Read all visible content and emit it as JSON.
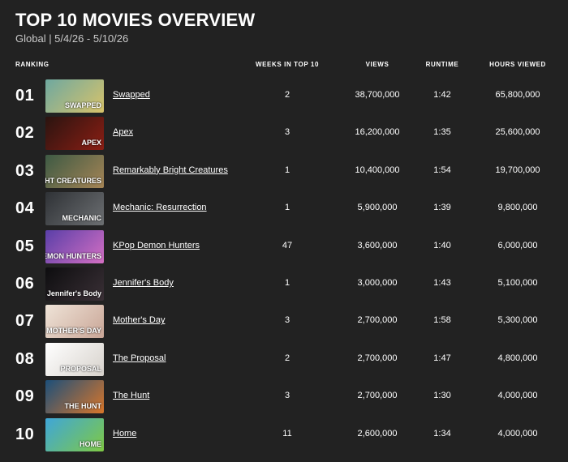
{
  "title": "TOP 10 MOVIES OVERVIEW",
  "subtitle": "Global | 5/4/26 - 5/10/26",
  "columns": {
    "ranking": "RANKING",
    "weeks": "WEEKS IN TOP 10",
    "views": "VIEWS",
    "runtime": "RUNTIME",
    "hours": "HOURS VIEWED"
  },
  "rows": [
    {
      "rank": "01",
      "name": "Swapped",
      "weeks": "2",
      "views": "38,700,000",
      "runtime": "1:42",
      "hours": "65,800,000",
      "thumb_text": "SWAPPED",
      "thumb_colors": [
        "#6ea8a0",
        "#d8c36a"
      ]
    },
    {
      "rank": "02",
      "name": "Apex",
      "weeks": "3",
      "views": "16,200,000",
      "runtime": "1:35",
      "hours": "25,600,000",
      "thumb_text": "APEX",
      "thumb_colors": [
        "#2a1410",
        "#8b1e14"
      ]
    },
    {
      "rank": "03",
      "name": "Remarkably Bright Creatures",
      "weeks": "1",
      "views": "10,400,000",
      "runtime": "1:54",
      "hours": "19,700,000",
      "thumb_text": "REMARKABLY BRIGHT CREATURES",
      "thumb_colors": [
        "#3d5a44",
        "#a58455"
      ]
    },
    {
      "rank": "04",
      "name": "Mechanic: Resurrection",
      "weeks": "1",
      "views": "5,900,000",
      "runtime": "1:39",
      "hours": "9,800,000",
      "thumb_text": "MECHANIC",
      "thumb_colors": [
        "#2f3236",
        "#6c6f72"
      ]
    },
    {
      "rank": "05",
      "name": "KPop Demon Hunters",
      "weeks": "47",
      "views": "3,600,000",
      "runtime": "1:40",
      "hours": "6,000,000",
      "thumb_text": "KPOP DEMON HUNTERS",
      "thumb_colors": [
        "#5a3fa8",
        "#d46fc3"
      ]
    },
    {
      "rank": "06",
      "name": "Jennifer's Body",
      "weeks": "1",
      "views": "3,000,000",
      "runtime": "1:43",
      "hours": "5,100,000",
      "thumb_text": "Jennifer's Body",
      "thumb_colors": [
        "#0d0d0f",
        "#3a3036"
      ]
    },
    {
      "rank": "07",
      "name": "Mother's Day",
      "weeks": "3",
      "views": "2,700,000",
      "runtime": "1:58",
      "hours": "5,300,000",
      "thumb_text": "MOTHER'S DAY",
      "thumb_colors": [
        "#efe4d8",
        "#c9a596"
      ]
    },
    {
      "rank": "08",
      "name": "The Proposal",
      "weeks": "2",
      "views": "2,700,000",
      "runtime": "1:47",
      "hours": "4,800,000",
      "thumb_text": "PROPOSAL",
      "thumb_colors": [
        "#ffffff",
        "#d7d2cc"
      ]
    },
    {
      "rank": "09",
      "name": "The Hunt",
      "weeks": "3",
      "views": "2,700,000",
      "runtime": "1:30",
      "hours": "4,000,000",
      "thumb_text": "THE HUNT",
      "thumb_colors": [
        "#1c4f7a",
        "#d9762a"
      ]
    },
    {
      "rank": "10",
      "name": "Home",
      "weeks": "11",
      "views": "2,600,000",
      "runtime": "1:34",
      "hours": "4,000,000",
      "thumb_text": "HOME",
      "thumb_colors": [
        "#3fa6d9",
        "#7fc943"
      ]
    }
  ]
}
